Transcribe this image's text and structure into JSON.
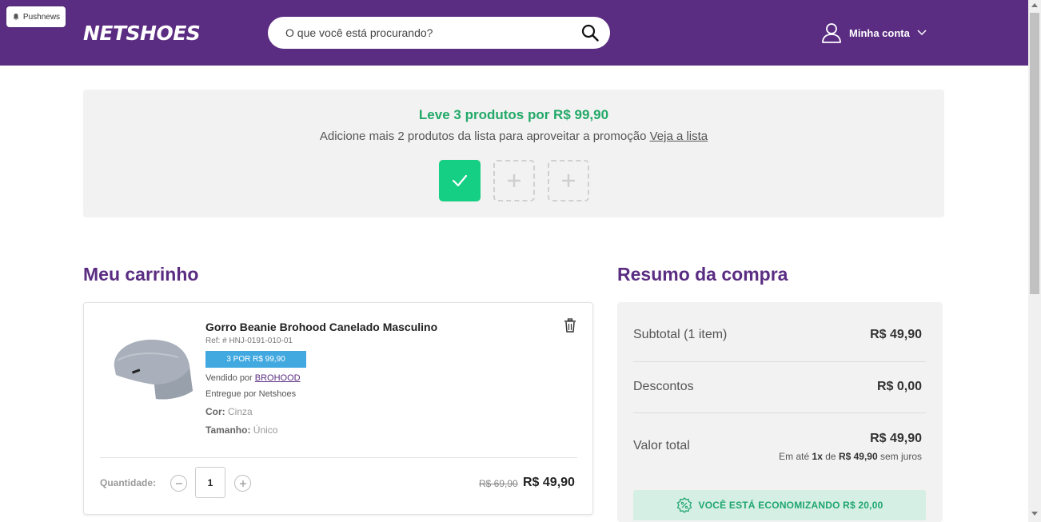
{
  "header": {
    "push_badge": "Pushnews",
    "logo": "NETSHOES",
    "search_placeholder": "O que você está procurando?",
    "account_label": "Minha conta"
  },
  "promo": {
    "title": "Leve 3 produtos por R$ 99,90",
    "subtitle": "Adicione mais 2 produtos da lista para aproveitar a promoção",
    "link": "Veja a lista",
    "slots": [
      "filled",
      "empty",
      "empty"
    ]
  },
  "cart": {
    "title": "Meu carrinho",
    "item": {
      "name": "Gorro Beanie Brohood Canelado Masculino",
      "ref": "Ref: # HNJ-0191-010-01",
      "badge": "3 POR R$ 99,90",
      "sold_by_label": "Vendido por",
      "seller": "BROHOOD",
      "delivered_by": "Entregue por Netshoes",
      "color_label": "Cor:",
      "color_value": "Cinza",
      "size_label": "Tamanho:",
      "size_value": "Único",
      "quantity_label": "Quantidade:",
      "quantity": "1",
      "old_price": "R$ 69,90",
      "price": "R$ 49,90"
    }
  },
  "summary": {
    "title": "Resumo da compra",
    "subtotal_label": "Subtotal (1 item)",
    "subtotal_value": "R$ 49,90",
    "discount_label": "Descontos",
    "discount_value": "R$ 0,00",
    "total_label": "Valor total",
    "total_value": "R$ 49,90",
    "installments_prefix": "Em até",
    "installments_count": "1x",
    "installments_mid": "de",
    "installments_value": "R$ 49,90",
    "installments_suffix": "sem juros",
    "saving_text": "VOCÊ ESTÁ ECONOMIZANDO R$ 20,00"
  },
  "colors": {
    "brand_purple": "#5b2d82",
    "promo_green": "#22a968",
    "slot_green": "#15cf85",
    "badge_blue": "#41a9e0",
    "saving_bg": "#d6efe4"
  }
}
